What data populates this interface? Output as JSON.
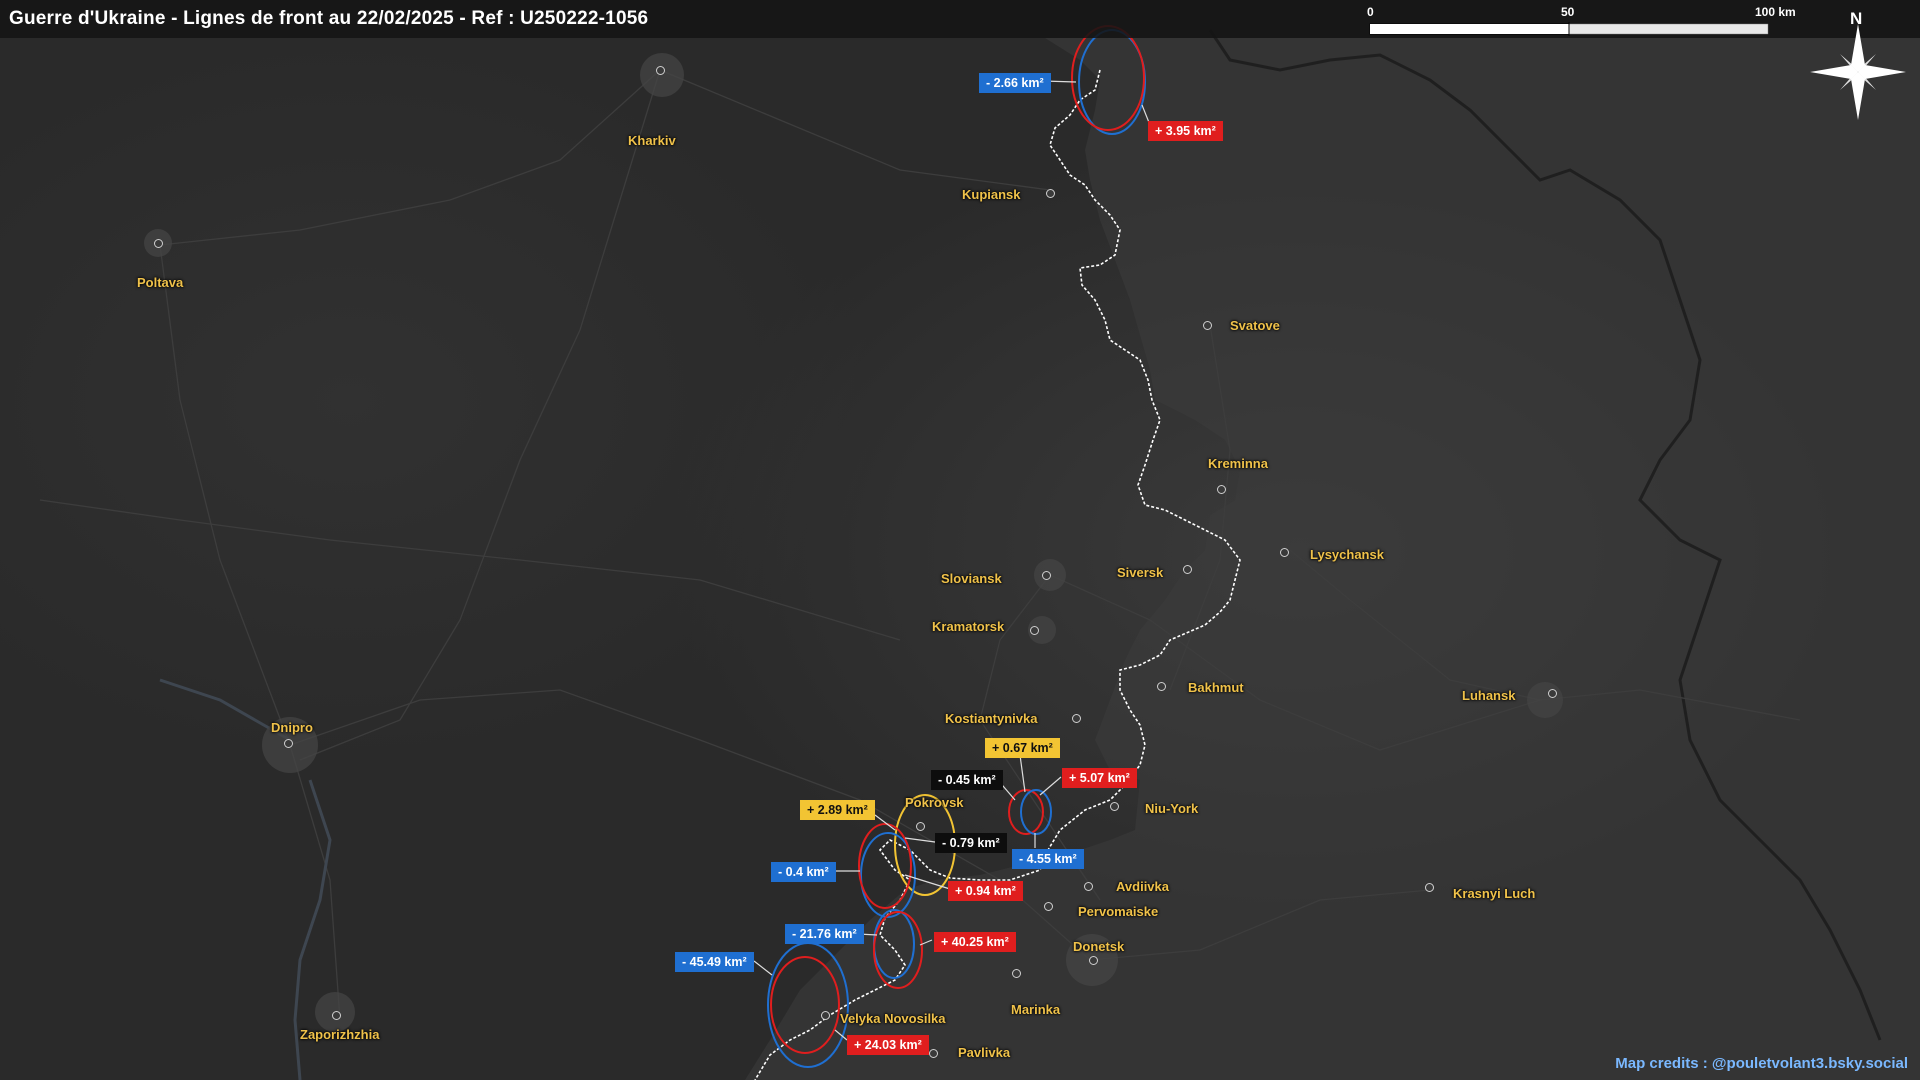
{
  "title": "Guerre d'Ukraine - Lignes de front au 22/02/2025 - Ref : U250222-1056",
  "scale_bar": {
    "labels": [
      "0",
      "50",
      "100 km"
    ]
  },
  "north_label": "N",
  "credits": "Map credits : @pouletvolant3.bsky.social",
  "cities": [
    "Kharkiv",
    "Kupiansk",
    "Poltava",
    "Svatove",
    "Kreminna",
    "Lysychansk",
    "Sloviansk",
    "Siversk",
    "Kramatorsk",
    "Bakhmut",
    "Luhansk",
    "Kostiantynivka",
    "Dnipro",
    "Pokrovsk",
    "Niu-York",
    "Avdiivka",
    "Krasnyi Luch",
    "Pervomaiske",
    "Donetsk",
    "Marinka",
    "Velyka Novosilka",
    "Zaporizhzhia",
    "Pavlivka"
  ],
  "changes": [
    {
      "text": "- 2.66 km²",
      "kind": "loss"
    },
    {
      "text": "+ 3.95 km²",
      "kind": "gain"
    },
    {
      "text": "+ 0.67 km²",
      "kind": "yellow"
    },
    {
      "text": "- 0.45 km²",
      "kind": "neutral"
    },
    {
      "text": "+ 5.07 km²",
      "kind": "gain"
    },
    {
      "text": "+ 2.89 km²",
      "kind": "yellow"
    },
    {
      "text": "- 0.79 km²",
      "kind": "neutral"
    },
    {
      "text": "- 4.55 km²",
      "kind": "loss"
    },
    {
      "text": "- 0.4 km²",
      "kind": "loss"
    },
    {
      "text": "+ 0.94 km²",
      "kind": "gain"
    },
    {
      "text": "- 21.76 km²",
      "kind": "loss"
    },
    {
      "text": "+ 40.25 km²",
      "kind": "gain"
    },
    {
      "text": "- 45.49 km²",
      "kind": "loss"
    },
    {
      "text": "+ 24.03 km²",
      "kind": "gain"
    }
  ],
  "colors": {
    "gain": "#e01e1e",
    "loss": "#1f6fd1",
    "yellow": "#f2c433",
    "neutral": "#0d0d0d",
    "city_label": "#f0c24a",
    "front_line": "#ffffff",
    "credits": "#7ab8ff"
  }
}
